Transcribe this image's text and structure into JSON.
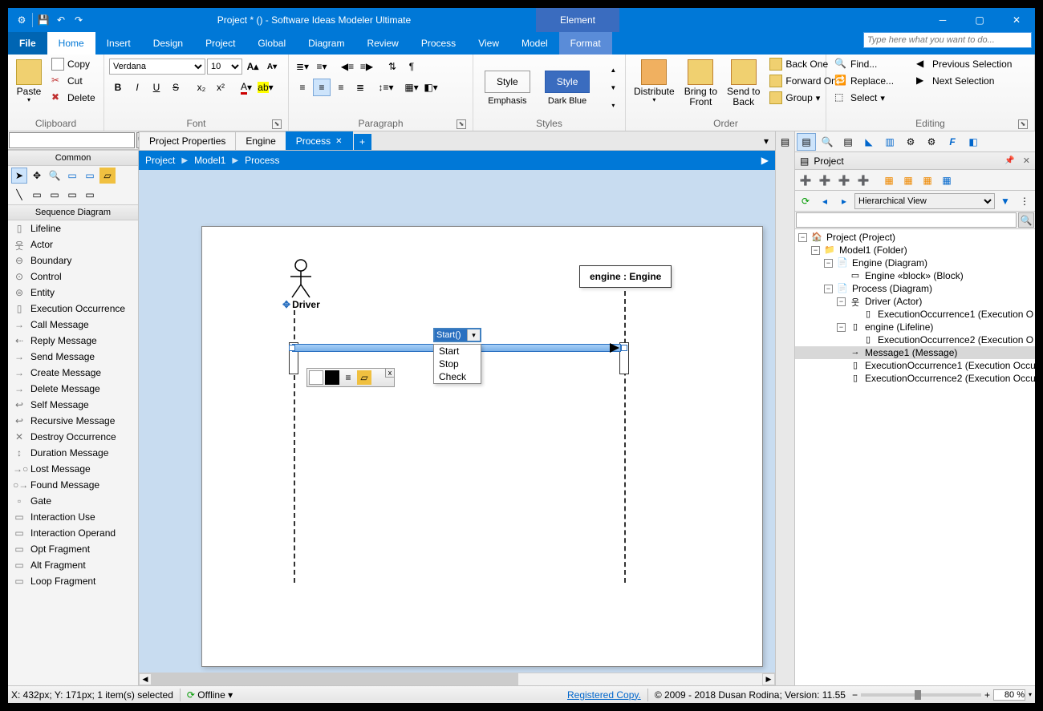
{
  "titlebar": {
    "title": "Project *  ()  - Software Ideas Modeler Ultimate",
    "context_tab": "Element"
  },
  "menu": {
    "file": "File",
    "tabs": [
      "Home",
      "Insert",
      "Design",
      "Project",
      "Global",
      "Diagram",
      "Review",
      "Process",
      "View",
      "Model",
      "Format"
    ],
    "active": "Home",
    "search_placeholder": "Type here what you want to do..."
  },
  "ribbon": {
    "clipboard": {
      "label": "Clipboard",
      "paste": "Paste",
      "copy": "Copy",
      "cut": "Cut",
      "delete": "Delete"
    },
    "font": {
      "label": "Font",
      "family": "Verdana",
      "size": "10"
    },
    "paragraph": {
      "label": "Paragraph"
    },
    "styles": {
      "label": "Styles",
      "style_btn": "Style",
      "emphasis": "Emphasis",
      "darkblue": "Dark Blue"
    },
    "order": {
      "label": "Order",
      "distribute": "Distribute",
      "bringfront": "Bring to\nFront",
      "sendback": "Send to\nBack",
      "backone": "Back One",
      "forwardone": "Forward One",
      "group": "Group"
    },
    "editing": {
      "label": "Editing",
      "find": "Find...",
      "replace": "Replace...",
      "select": "Select",
      "prevsel": "Previous Selection",
      "nextsel": "Next Selection"
    }
  },
  "left": {
    "common": "Common",
    "section": "Sequence Diagram",
    "items": [
      "Lifeline",
      "Actor",
      "Boundary",
      "Control",
      "Entity",
      "Execution Occurrence",
      "Call Message",
      "Reply Message",
      "Send Message",
      "Create Message",
      "Delete Message",
      "Self Message",
      "Recursive Message",
      "Destroy Occurrence",
      "Duration Message",
      "Lost Message",
      "Found Message",
      "Gate",
      "Interaction Use",
      "Interaction Operand",
      "Opt Fragment",
      "Alt Fragment",
      "Loop Fragment"
    ]
  },
  "doctabs": {
    "t1": "Project Properties",
    "t2": "Engine",
    "t3": "Process"
  },
  "breadcrumb": [
    "Project",
    "Model1",
    "Process"
  ],
  "canvas": {
    "actor": "Driver",
    "engine": "engine : Engine",
    "msg_edit": "Start()",
    "suggestions": [
      "Start",
      "Stop",
      "Check"
    ]
  },
  "project_panel": {
    "title": "Project",
    "view": "Hierarchical View",
    "tree": [
      {
        "d": 0,
        "exp": "-",
        "ic": "🏠",
        "t": "Project (Project)"
      },
      {
        "d": 1,
        "exp": "-",
        "ic": "📁",
        "t": "Model1 (Folder)"
      },
      {
        "d": 2,
        "exp": "-",
        "ic": "📄",
        "t": "Engine (Diagram)"
      },
      {
        "d": 3,
        "exp": "",
        "ic": "▭",
        "t": "Engine «block» (Block)"
      },
      {
        "d": 2,
        "exp": "-",
        "ic": "📄",
        "t": "Process (Diagram)"
      },
      {
        "d": 3,
        "exp": "-",
        "ic": "웃",
        "t": "Driver (Actor)"
      },
      {
        "d": 4,
        "exp": "",
        "ic": "▯",
        "t": "ExecutionOccurrence1 (Execution O"
      },
      {
        "d": 3,
        "exp": "-",
        "ic": "▯",
        "t": "engine (Lifeline)"
      },
      {
        "d": 4,
        "exp": "",
        "ic": "▯",
        "t": "ExecutionOccurrence2 (Execution O"
      },
      {
        "d": 3,
        "exp": "",
        "ic": "→",
        "t": "Message1 (Message)",
        "sel": true
      },
      {
        "d": 3,
        "exp": "",
        "ic": "▯",
        "t": "ExecutionOccurrence1 (Execution Occu"
      },
      {
        "d": 3,
        "exp": "",
        "ic": "▯",
        "t": "ExecutionOccurrence2 (Execution Occu"
      }
    ]
  },
  "status": {
    "coords": "X: 432px; Y: 171px; 1 item(s) selected",
    "offline": "Offline",
    "registered": "Registered Copy.",
    "copyright": "© 2009 - 2018 Dusan Rodina; Version: 11.55",
    "zoom": "80 %"
  }
}
